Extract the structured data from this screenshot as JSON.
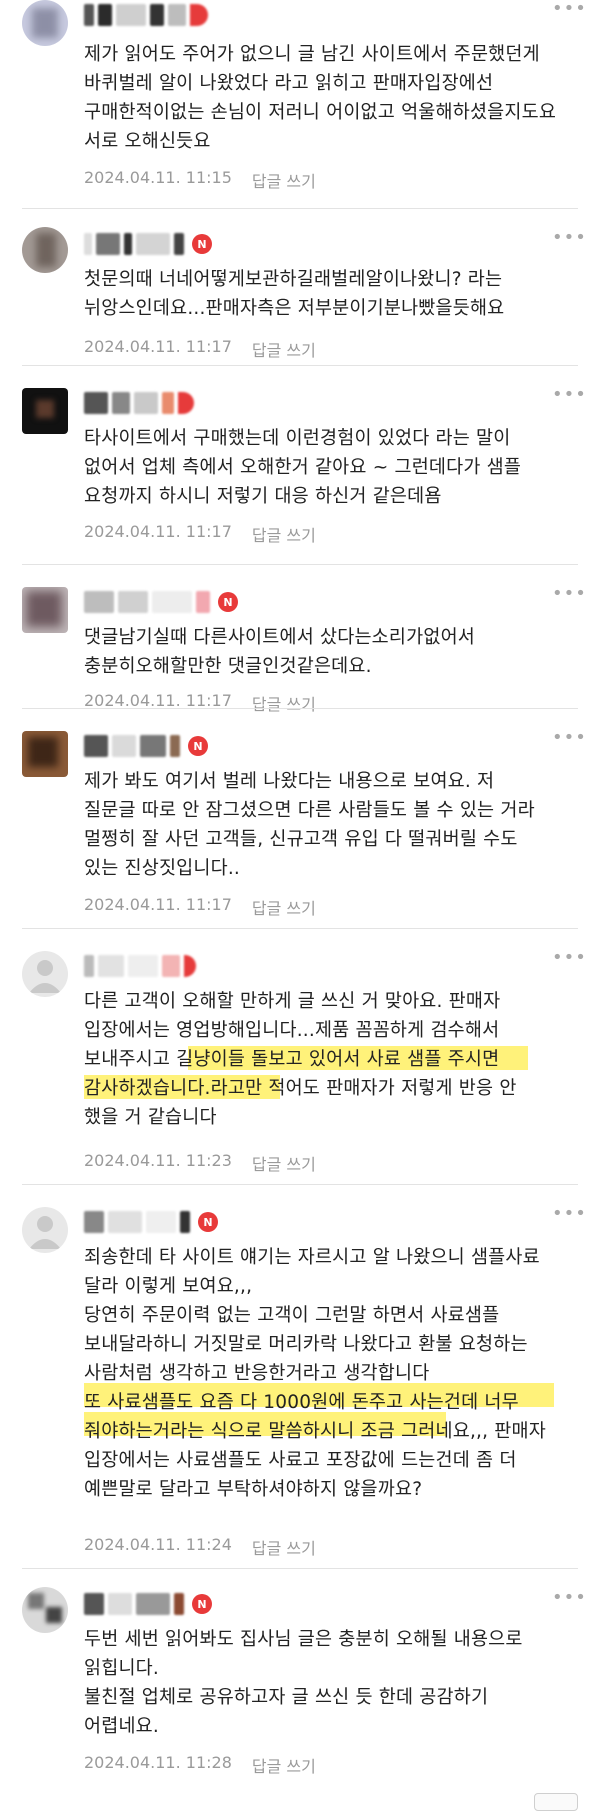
{
  "comments": [
    {
      "lines": [
        "제가 읽어도 주어가 없으니 글 남긴 사이트에서 주문했던게",
        "바퀴벌레 알이 나왔었다 라고 읽히고 판매자입장에선",
        "구매한적이없는 손님이 저러니 어이없고 억울해하셨을지도요",
        "서로 오해신듯요"
      ],
      "time": "2024.04.11. 11:15",
      "reply": "답글 쓰기"
    },
    {
      "lines": [
        "첫문의때 너네어떻게보관하길래벌레알이나왔니? 라는",
        "뉘앙스인데요...판매자측은 저부분이기분나빴을듯해요"
      ],
      "time": "2024.04.11. 11:17",
      "reply": "답글 쓰기"
    },
    {
      "lines": [
        "타사이트에서 구매했는데 이런경험이 있었다 라는 말이",
        "없어서 업체 측에서 오해한거 같아요 ~ 그런데다가 샘플",
        "요청까지 하시니 저렇기 대응 하신거 같은데욤"
      ],
      "time": "2024.04.11. 11:17",
      "reply": "답글 쓰기"
    },
    {
      "lines": [
        "댓글남기실때 다른사이트에서 샀다는소리가없어서",
        "충분히오해할만한 댓글인것같은데요."
      ],
      "time": "2024.04.11. 11:17",
      "reply": "답글 쓰기"
    },
    {
      "lines": [
        "제가 봐도 여기서 벌레 나왔다는 내용으로 보여요. 저",
        "질문글 따로 안 잠그셨으면 다른 사람들도 볼 수 있는 거라",
        "멀쩡히 잘 사던 고객들, 신규고객 유입 다 떨궈버릴 수도",
        "있는 진상짓입니다.."
      ],
      "time": "2024.04.11. 11:17",
      "reply": "답글 쓰기"
    },
    {
      "lines": [
        "다른 고객이 오해할 만하게 글 쓰신 거 맞아요. 판매자",
        "입장에서는 영업방해입니다...제품 꼼꼼하게 검수해서",
        "보내주시고 길냥이들 돌보고 있어서 사료 샘플 주시면",
        "감사하겠습니다.라고만 적어도 판매자가 저렇게 반응 안",
        "했을 거 같습니다"
      ],
      "time": "2024.04.11. 11:23",
      "reply": "답글 쓰기"
    },
    {
      "lines": [
        "죄송한데 타 사이트 얘기는 자르시고 알 나왔으니 샘플사료",
        "달라 이렇게 보여요,,,",
        "당연히 주문이력 없는 고객이 그런말 하면서 사료샘플",
        "보내달라하니 거짓말로 머리카락 나왔다고 환불 요청하는",
        "사람처럼 생각하고 반응한거라고 생각합니다",
        "또 사료샘플도 요즘 다 1000원에 돈주고 사는건데 너무",
        "줘야하는거라는 식으로 말씀하시니 조금 그러네요,,, 판매자",
        "입장에서는 사료샘플도 사료고 포장값에 드는건데 좀 더",
        "예쁜말로 달라고 부탁하셔야하지 않을까요?"
      ],
      "time": "2024.04.11. 11:24",
      "reply": "답글 쓰기"
    },
    {
      "lines": [
        "두번 세번 읽어봐도 집사님 글은 충분히 오해될 내용으로",
        "읽힙니다.",
        "불친절 업체로 공유하고자 글 쓰신 듯 한데 공감하기",
        "어렵네요."
      ],
      "time": "2024.04.11. 11:28",
      "reply": "답글 쓰기"
    }
  ],
  "badge_text": "N",
  "more_glyph": "•••",
  "colors": {
    "highlight": "#fff27a",
    "badge": "#e83a3a",
    "meta": "#9a9a9a"
  }
}
